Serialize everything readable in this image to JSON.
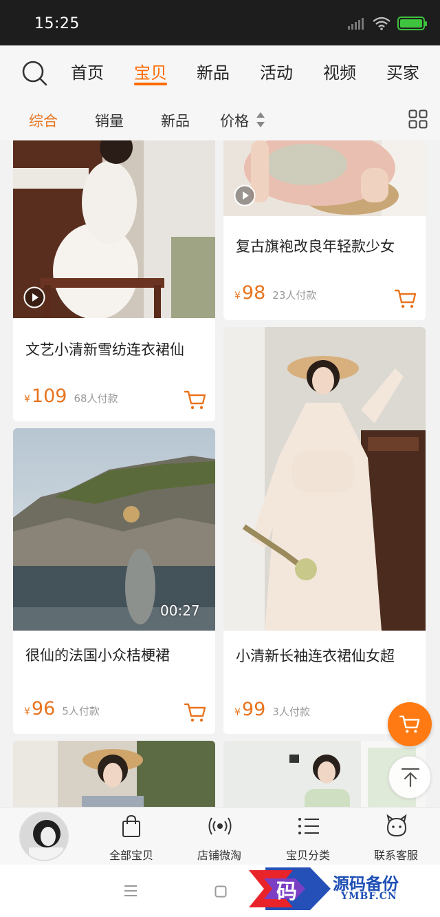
{
  "status_bar": {
    "time": "15:25"
  },
  "top_nav": {
    "tabs": [
      {
        "label": "首页"
      },
      {
        "label": "宝贝"
      },
      {
        "label": "新品"
      },
      {
        "label": "活动"
      },
      {
        "label": "视频"
      },
      {
        "label": "买家"
      }
    ],
    "active_index": 1
  },
  "sort_bar": {
    "items": [
      {
        "label": "综合"
      },
      {
        "label": "销量"
      },
      {
        "label": "新品"
      },
      {
        "label": "价格"
      }
    ],
    "active_index": 0
  },
  "products": [
    {
      "title": "文艺小清新雪纺连衣裙仙",
      "currency": "¥",
      "price": "109",
      "sold": "68人付款",
      "has_video": true
    },
    {
      "title": "复古旗袍改良年轻款少女",
      "currency": "¥",
      "price": "98",
      "sold": "23人付款",
      "has_video": true
    },
    {
      "title": "很仙的法国小众桔梗裙",
      "currency": "¥",
      "price": "96",
      "sold": "5人付款",
      "has_video": true,
      "duration": "00:27"
    },
    {
      "title": "小清新长袖连衣裙仙女超",
      "currency": "¥",
      "price": "99",
      "sold": "3人付款",
      "has_video": false
    }
  ],
  "bottom_tabs": [
    {
      "label": "全部宝贝",
      "icon": "shopping-bag-icon"
    },
    {
      "label": "店铺微淘",
      "icon": "broadcast-icon"
    },
    {
      "label": "宝贝分类",
      "icon": "category-list-icon"
    },
    {
      "label": "联系客服",
      "icon": "customer-service-icon"
    }
  ],
  "watermark": {
    "glyph": "码",
    "name": "源码备份",
    "url": "YMBF.CN"
  },
  "colors": {
    "accent": "#ff6a00",
    "price": "#e8731e",
    "status_bar": "#1d1d1d",
    "battery": "#3ec43e"
  }
}
